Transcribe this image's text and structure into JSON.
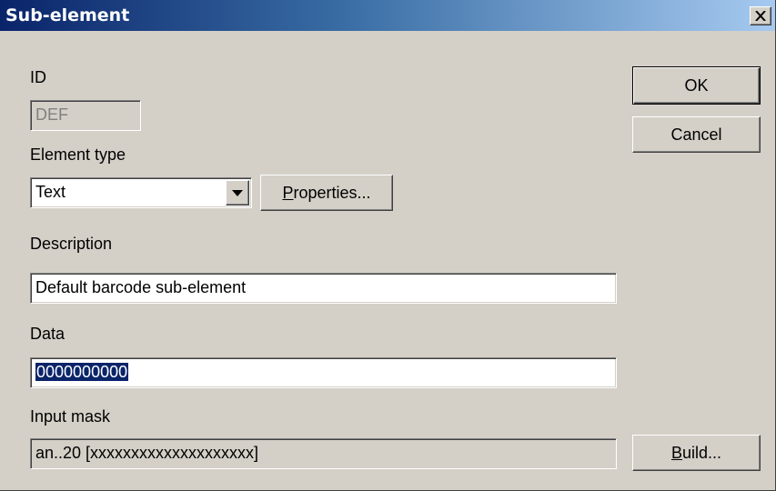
{
  "window": {
    "title": "Sub-element"
  },
  "form": {
    "id_label": "ID",
    "id_value": "DEF",
    "element_type_label": "Element type",
    "element_type_value": "Text",
    "properties_button": {
      "mnemonic": "P",
      "rest": "roperties..."
    },
    "description_label": "Description",
    "description_value": "Default barcode sub-element",
    "data_label": "Data",
    "data_value": "0000000000",
    "input_mask_label": "Input mask",
    "input_mask_value": "an..20 [xxxxxxxxxxxxxxxxxxxx]",
    "build_button": {
      "mnemonic": "B",
      "rest": "uild..."
    }
  },
  "buttons": {
    "ok": "OK",
    "cancel": "Cancel"
  },
  "icons": {
    "close": "close-icon",
    "dropdown": "chevron-down-icon"
  },
  "colors": {
    "titlebar_start": "#0a246a",
    "titlebar_end": "#a6caf0",
    "face": "#d4d0c8",
    "selection": "#0a246a"
  }
}
